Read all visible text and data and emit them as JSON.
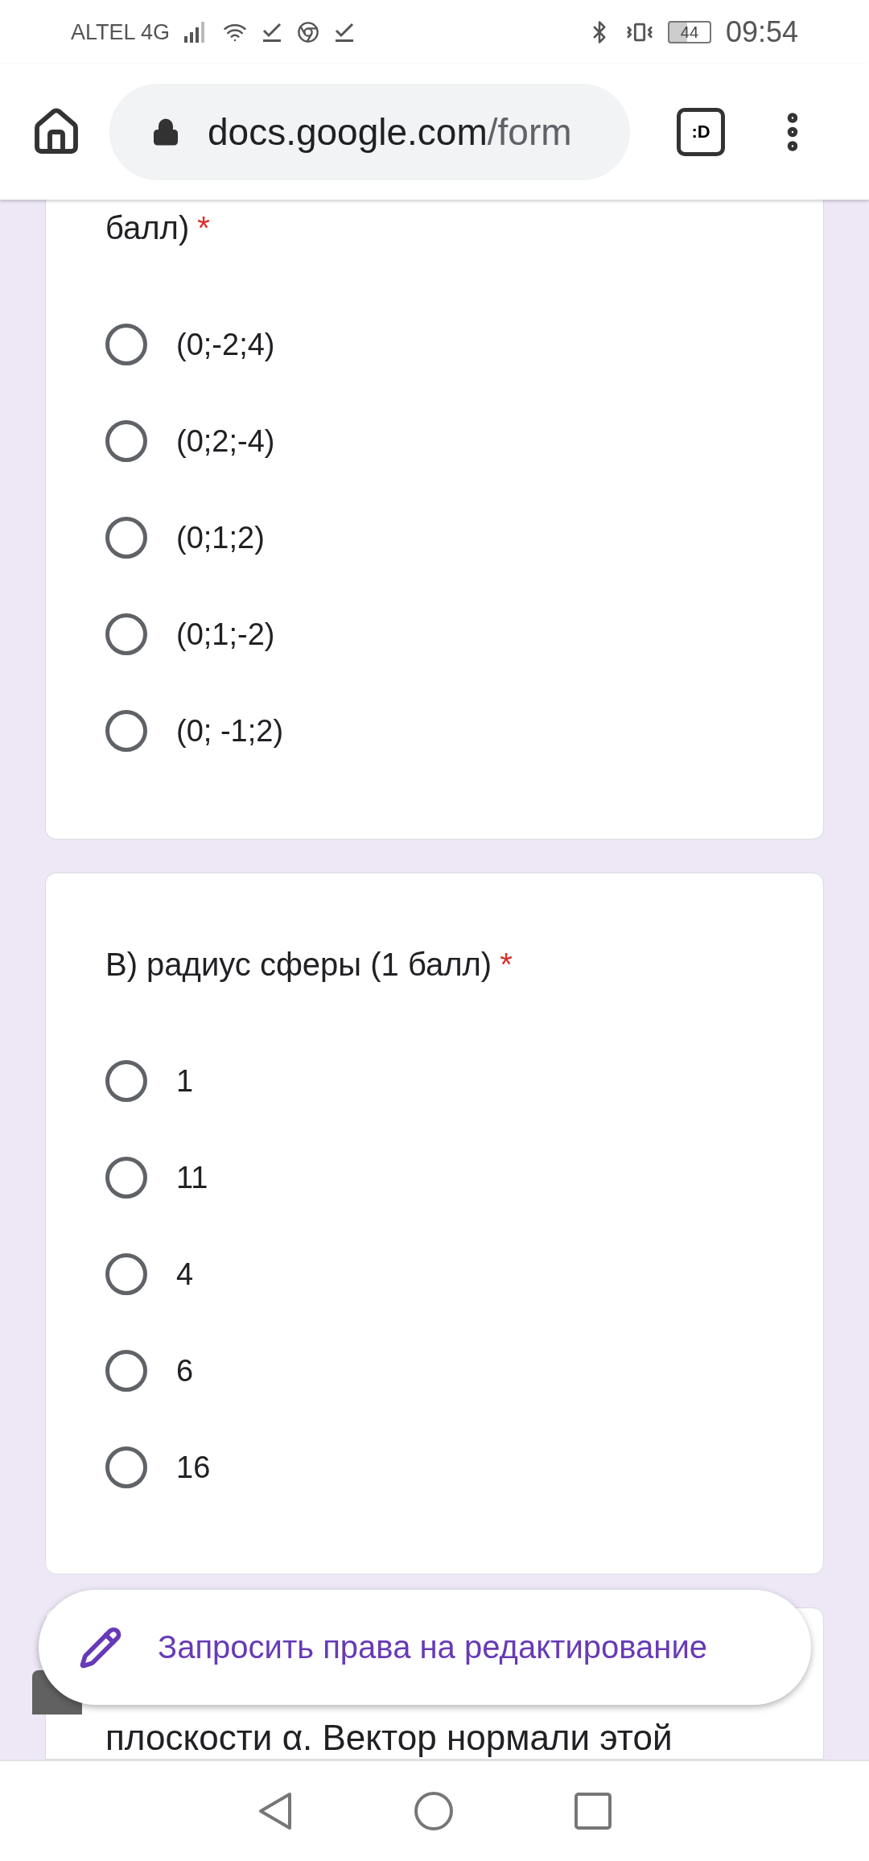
{
  "status_bar": {
    "carrier": "ALTEL 4G",
    "battery": "44",
    "time": "09:54"
  },
  "browser": {
    "url_host": "docs.google.com",
    "url_path": "/form",
    "tab_badge": ":D"
  },
  "questions": [
    {
      "title": "балл)",
      "required_mark": "*",
      "options": [
        {
          "label": "(0;-2;4)",
          "selected": false
        },
        {
          "label": "(0;2;-4)",
          "selected": false
        },
        {
          "label": "(0;1;2)",
          "selected": false
        },
        {
          "label": "(0;1;-2)",
          "selected": false
        },
        {
          "label": "(0; -1;2)",
          "selected": false
        }
      ]
    },
    {
      "title": "В) радиус сферы (1 балл)",
      "required_mark": "*",
      "options": [
        {
          "label": "1",
          "selected": false
        },
        {
          "label": "11",
          "selected": false
        },
        {
          "label": "4",
          "selected": false
        },
        {
          "label": "6",
          "selected": false
        },
        {
          "label": "16",
          "selected": false
        }
      ]
    }
  ],
  "next_question_text": "плоскости α. Вектор нормали этой",
  "edit_request_button": "Запросить права на редактирование"
}
